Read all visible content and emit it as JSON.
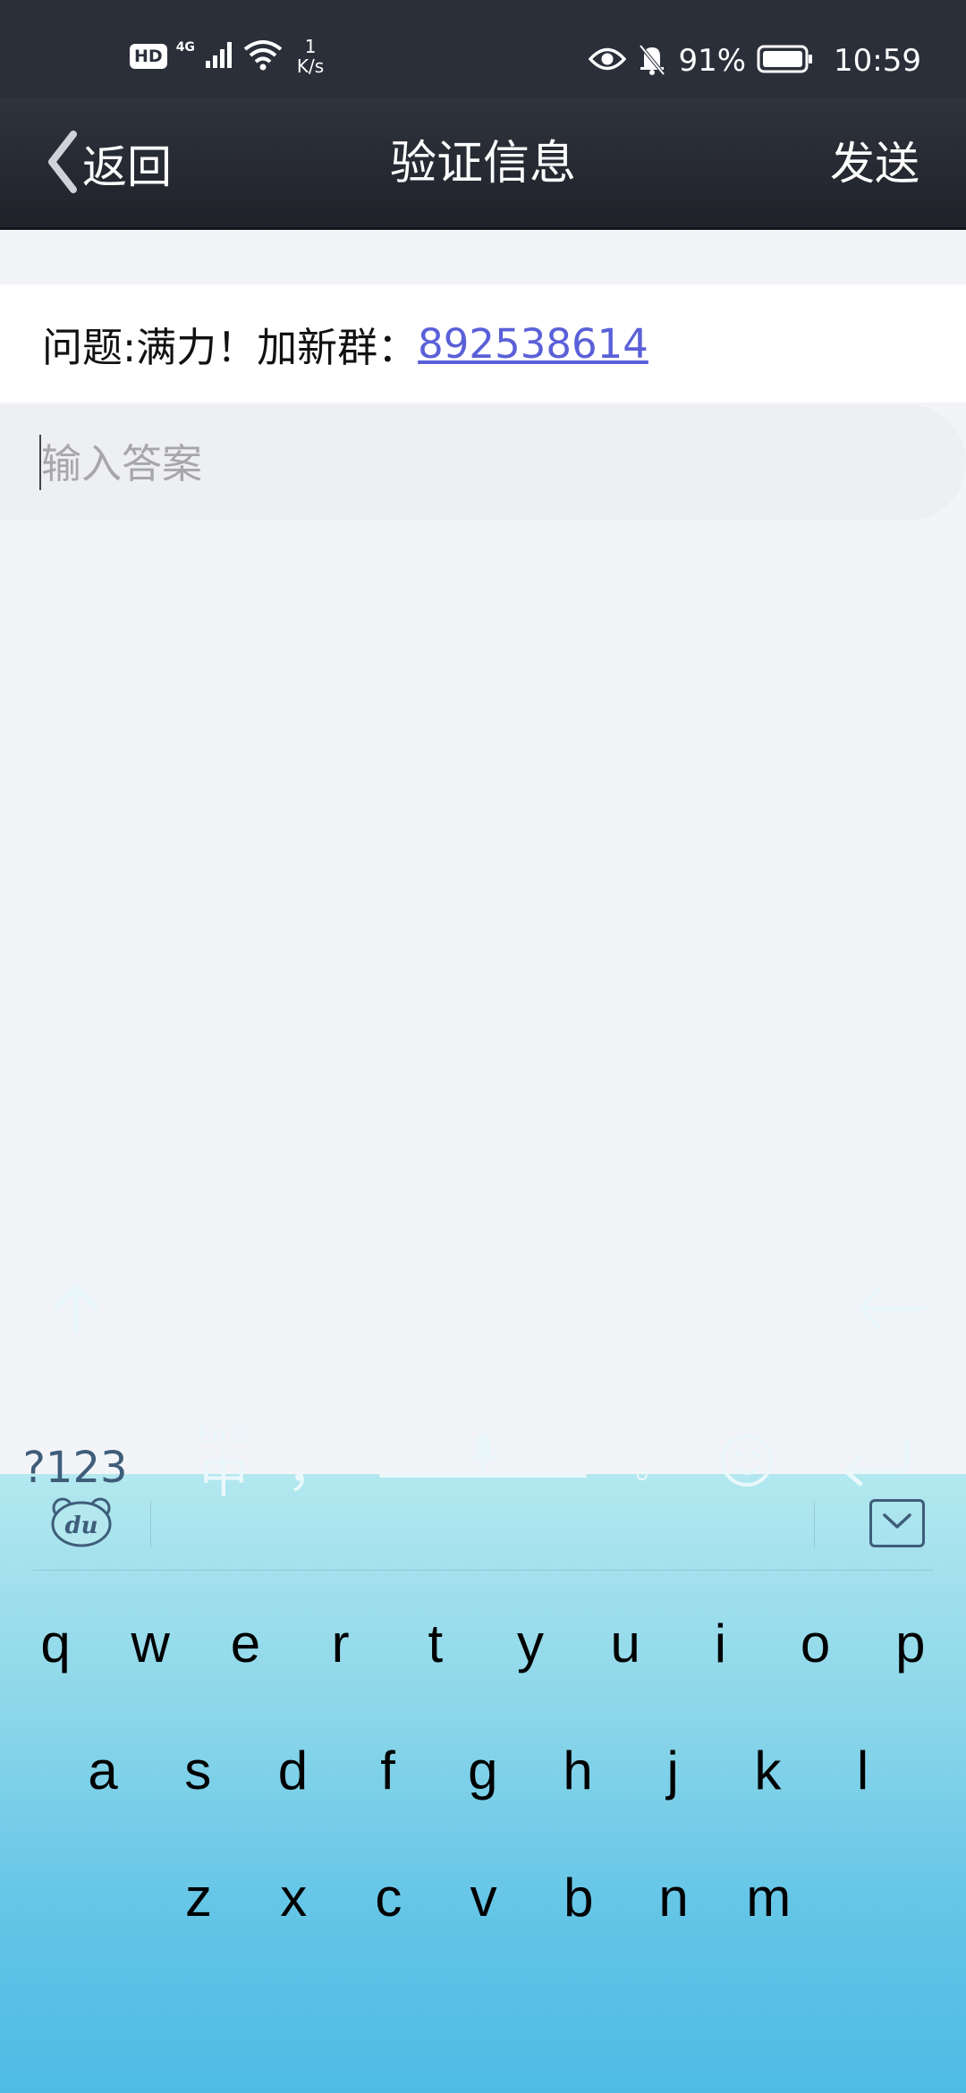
{
  "status_bar": {
    "hd": "HD",
    "network": "4G",
    "speed_value": "1",
    "speed_unit": "K/s",
    "battery": "91%",
    "time": "10:59"
  },
  "nav": {
    "back_label": "返回",
    "title": "验证信息",
    "send_label": "发送"
  },
  "question": {
    "text": "问题:满力！加新群：",
    "group_number": "892538614"
  },
  "answer": {
    "placeholder": "输入答案",
    "value": ""
  },
  "keyboard": {
    "row1": [
      "q",
      "w",
      "e",
      "r",
      "t",
      "y",
      "u",
      "i",
      "o",
      "p"
    ],
    "row2": [
      "a",
      "s",
      "d",
      "f",
      "g",
      "h",
      "j",
      "k",
      "l"
    ],
    "row3": [
      "z",
      "x",
      "c",
      "v",
      "b",
      "n",
      "m"
    ],
    "numbers_label": "?123",
    "lang_en": "En",
    "lang_zh": "中",
    "comma": "，",
    "period": "。"
  }
}
